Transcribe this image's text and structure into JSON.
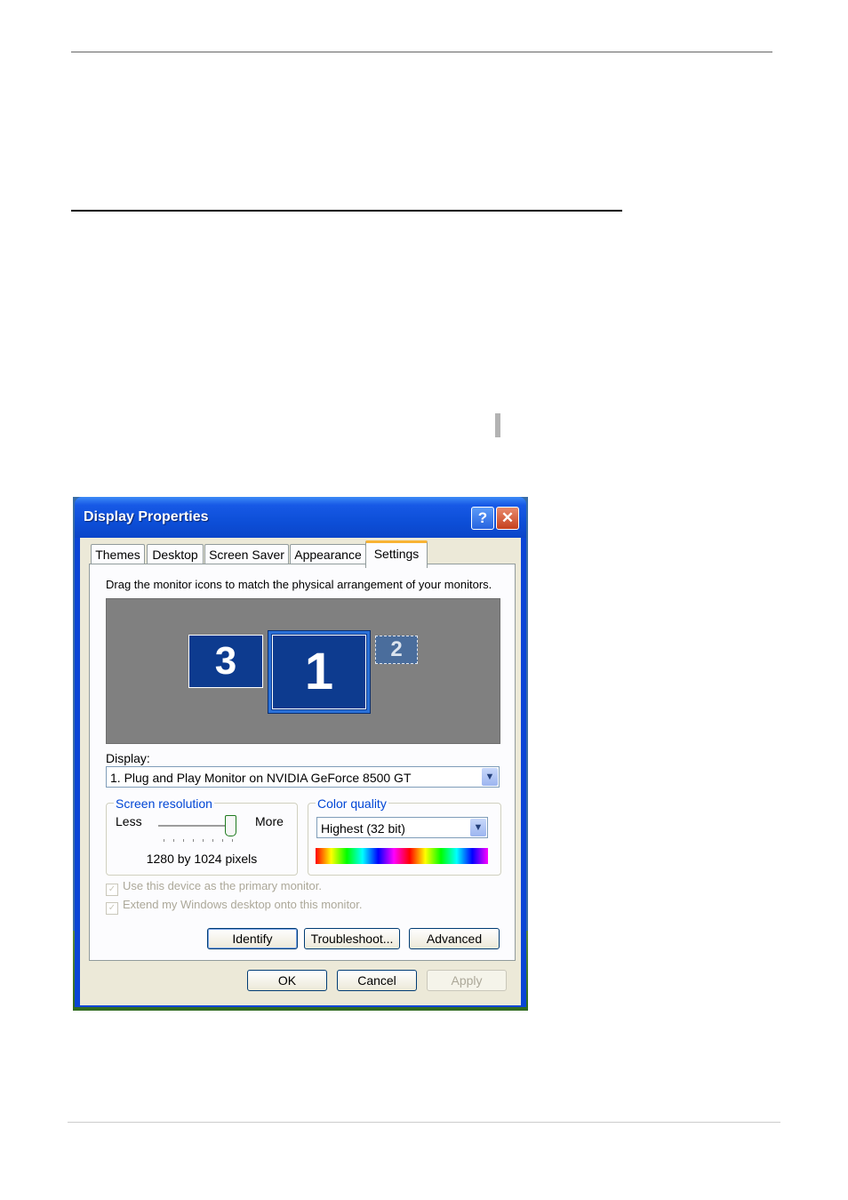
{
  "window": {
    "title": "Display Properties",
    "help_label": "?",
    "close_label": "✕"
  },
  "tabs": [
    {
      "label": "Themes"
    },
    {
      "label": "Desktop"
    },
    {
      "label": "Screen Saver"
    },
    {
      "label": "Appearance"
    },
    {
      "label": "Settings"
    }
  ],
  "settings": {
    "instructions": "Drag the monitor icons to match the physical arrangement of your monitors.",
    "monitors": [
      "3",
      "1",
      "2"
    ],
    "display_label": "Display:",
    "display_value": "1. Plug and Play Monitor on NVIDIA GeForce 8500 GT",
    "resolution": {
      "legend": "Screen resolution",
      "less": "Less",
      "more": "More",
      "value": "1280 by 1024 pixels"
    },
    "color_quality": {
      "legend": "Color quality",
      "value": "Highest (32 bit)"
    },
    "checkboxes": [
      {
        "label": "Use this device as the primary monitor.",
        "checked": true,
        "enabled": false
      },
      {
        "label": "Extend my Windows desktop onto this monitor.",
        "checked": true,
        "enabled": false
      }
    ],
    "buttons": {
      "identify": "Identify",
      "troubleshoot": "Troubleshoot...",
      "advanced": "Advanced"
    }
  },
  "dialog_buttons": {
    "ok": "OK",
    "cancel": "Cancel",
    "apply": "Apply"
  },
  "colors": {
    "titlebar": "#0a45d6",
    "client": "#ece9d8",
    "monitor": "#0d3b8f",
    "accent_tab": "#f8b334",
    "legend_text": "#0046d5"
  }
}
